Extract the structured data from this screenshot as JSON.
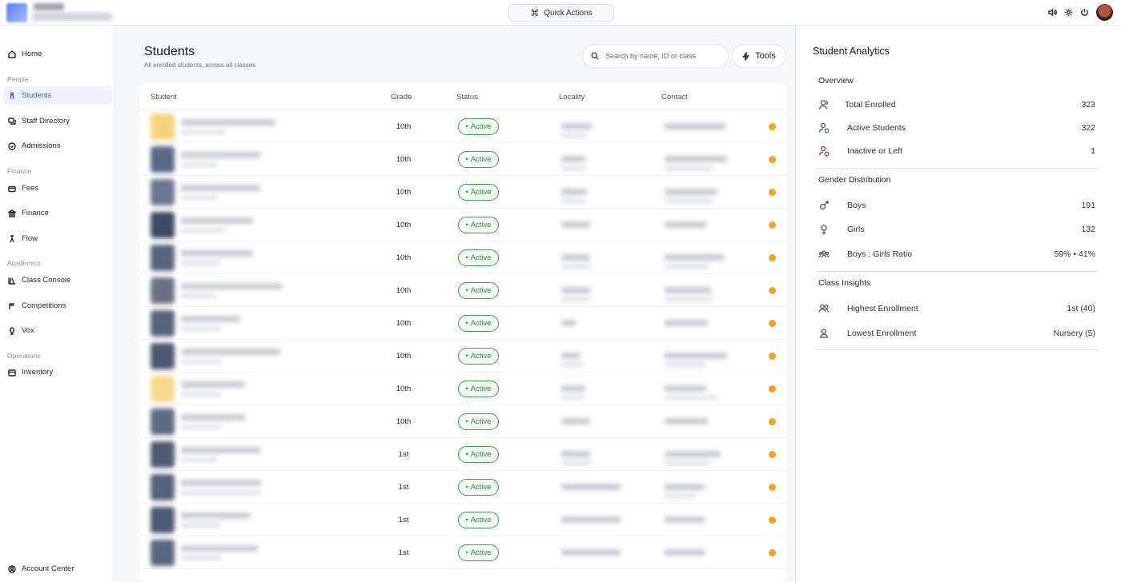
{
  "topbar": {
    "quick_actions_label": "Quick Actions",
    "icons": [
      "speaker-icon",
      "gear-icon",
      "power-icon"
    ]
  },
  "sidebar": {
    "items": [
      {
        "label": "Home",
        "icon": "home-icon"
      },
      {
        "label": "Students",
        "icon": "student-icon",
        "active": true
      },
      {
        "label": "Staff Directory",
        "icon": "staff-icon"
      },
      {
        "label": "Admissions",
        "icon": "admissions-icon"
      },
      {
        "label": "Fees",
        "icon": "fees-icon"
      },
      {
        "label": "Finance",
        "icon": "bank-icon"
      },
      {
        "label": "Flow",
        "icon": "flow-icon"
      },
      {
        "label": "Class Console",
        "icon": "books-icon"
      },
      {
        "label": "Competitions",
        "icon": "trophy-icon"
      },
      {
        "label": "Vox",
        "icon": "mic-icon"
      },
      {
        "label": "Inventory",
        "icon": "box-icon"
      }
    ],
    "sections": [
      "People",
      "Finance",
      "Academics",
      "Operations"
    ],
    "account_center": "Account Center"
  },
  "main": {
    "title": "Students",
    "subtitle": "All enrolled students, across all classes",
    "search_placeholder": "Search by name, ID or class",
    "tools_label": "Tools",
    "columns": [
      "Student",
      "Grade",
      "Status",
      "Locality",
      "Contact"
    ],
    "rows": [
      {
        "grade": "10th",
        "status": "Active"
      },
      {
        "grade": "10th",
        "status": "Active"
      },
      {
        "grade": "10th",
        "status": "Active"
      },
      {
        "grade": "10th",
        "status": "Active"
      },
      {
        "grade": "10th",
        "status": "Active"
      },
      {
        "grade": "10th",
        "status": "Active"
      },
      {
        "grade": "10th",
        "status": "Active"
      },
      {
        "grade": "10th",
        "status": "Active"
      },
      {
        "grade": "10th",
        "status": "Active"
      },
      {
        "grade": "10th",
        "status": "Active"
      },
      {
        "grade": "1st",
        "status": "Active"
      },
      {
        "grade": "1st",
        "status": "Active"
      },
      {
        "grade": "1st",
        "status": "Active"
      },
      {
        "grade": "1st",
        "status": "Active"
      }
    ]
  },
  "analytics": {
    "title": "Student Analytics",
    "overview": {
      "title": "Overview",
      "total_label": "Total Enrolled",
      "total_value": "323",
      "active_label": "Active Students",
      "active_value": "322",
      "inactive_label": "Inactive or Left",
      "inactive_value": "1"
    },
    "gender": {
      "title": "Gender Distribution",
      "boys_label": "Boys",
      "boys_value": "191",
      "girls_label": "Girls",
      "girls_value": "132",
      "ratio_label": "Boys : Girls Ratio",
      "ratio_value": "59% • 41%"
    },
    "classes": {
      "title": "Class Insights",
      "highest_label": "Highest Enrollment",
      "highest_value": "1st (40)",
      "lowest_label": "Lowest Enrollment",
      "lowest_value": "Nursery (5)"
    }
  },
  "colors": {
    "accent": "#2f5bd8",
    "active_green": "#2f8a3e",
    "status_dot": "#f4a21f"
  }
}
